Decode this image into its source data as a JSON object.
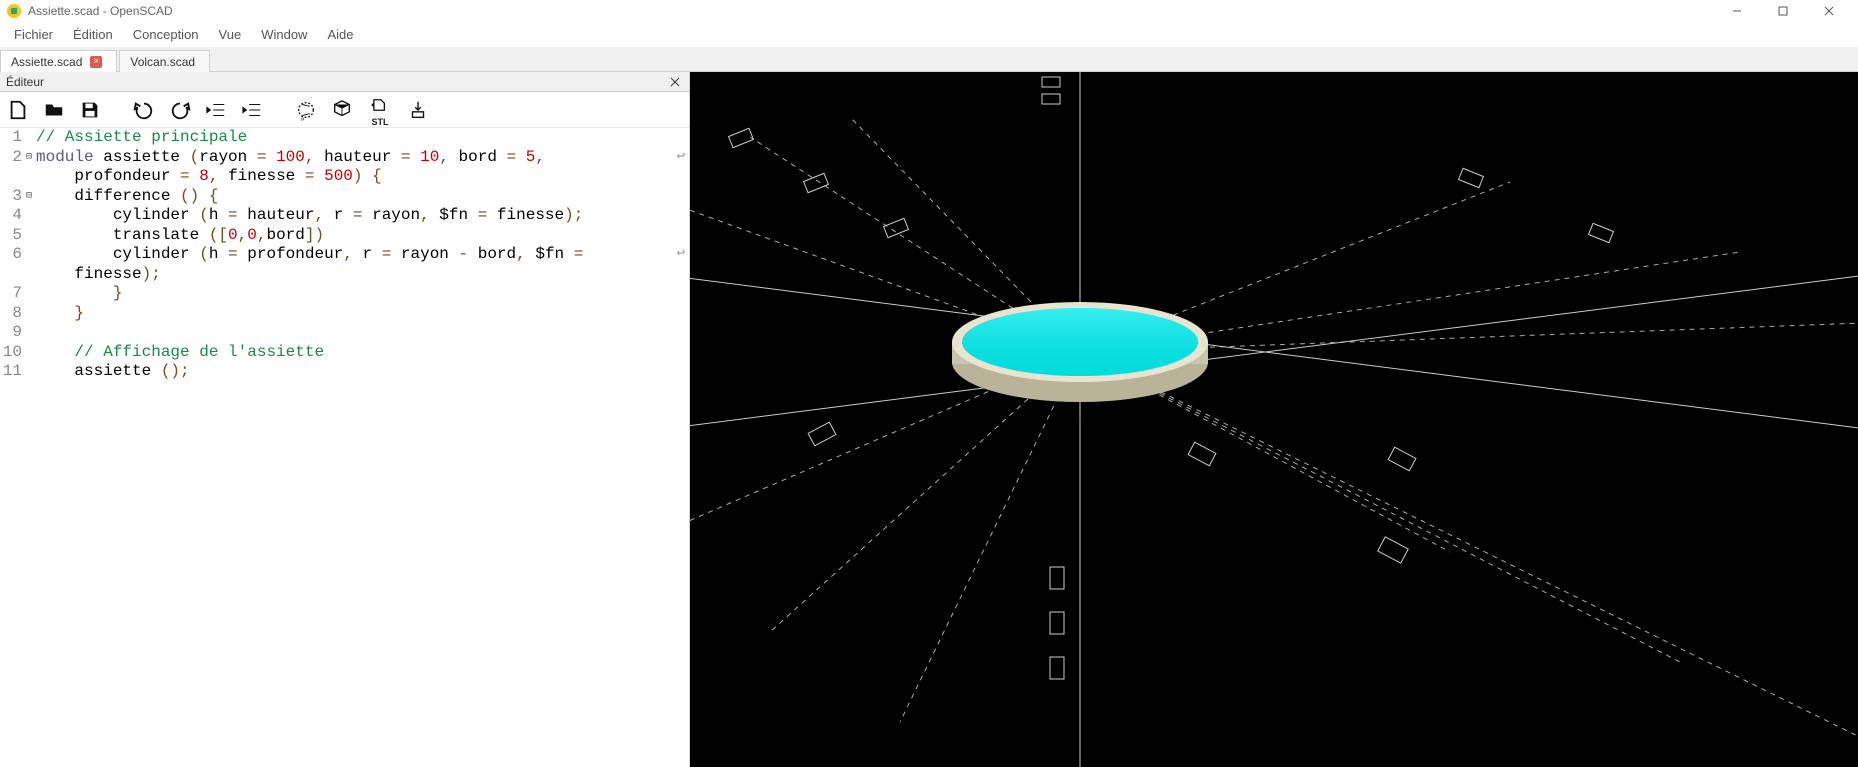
{
  "window": {
    "title": "Assiette.scad - OpenSCAD"
  },
  "menu": {
    "items": [
      "Fichier",
      "Édition",
      "Conception",
      "Vue",
      "Window",
      "Aide"
    ]
  },
  "tabs": [
    {
      "label": "Assiette.scad",
      "active": true,
      "closable": true
    },
    {
      "label": "Volcan.scad",
      "active": false,
      "closable": false
    }
  ],
  "panel": {
    "editor_title": "Éditeur"
  },
  "toolbar": {
    "items": [
      "new",
      "open",
      "save",
      "undo",
      "redo",
      "unindent",
      "indent",
      "preview",
      "render",
      "export-stl",
      "send-3d"
    ]
  },
  "code": {
    "lines": [
      {
        "n": 1,
        "fold": "",
        "segments": [
          {
            "t": "// Assiette principale",
            "c": "comment"
          }
        ]
      },
      {
        "n": 2,
        "fold": "⊟",
        "wrap": true,
        "segments": [
          {
            "t": "module",
            "c": "keyword"
          },
          {
            "t": " assiette ",
            "c": ""
          },
          {
            "t": "(",
            "c": "paren"
          },
          {
            "t": "rayon ",
            "c": ""
          },
          {
            "t": "=",
            "c": "op"
          },
          {
            "t": " ",
            "c": ""
          },
          {
            "t": "100",
            "c": "number"
          },
          {
            "t": ", ",
            "c": "paren"
          },
          {
            "t": "hauteur ",
            "c": ""
          },
          {
            "t": "=",
            "c": "op"
          },
          {
            "t": " ",
            "c": ""
          },
          {
            "t": "10",
            "c": "number"
          },
          {
            "t": ", ",
            "c": "paren"
          },
          {
            "t": "bord ",
            "c": ""
          },
          {
            "t": "=",
            "c": "op"
          },
          {
            "t": " ",
            "c": ""
          },
          {
            "t": "5",
            "c": "number"
          },
          {
            "t": ", ",
            "c": "paren"
          }
        ]
      },
      {
        "n": "",
        "fold": "",
        "segments": [
          {
            "t": "    profondeur ",
            "c": ""
          },
          {
            "t": "=",
            "c": "op"
          },
          {
            "t": " ",
            "c": ""
          },
          {
            "t": "8",
            "c": "number"
          },
          {
            "t": ", ",
            "c": "paren"
          },
          {
            "t": "finesse ",
            "c": ""
          },
          {
            "t": "=",
            "c": "op"
          },
          {
            "t": " ",
            "c": ""
          },
          {
            "t": "500",
            "c": "number"
          },
          {
            "t": ") {",
            "c": "paren"
          }
        ]
      },
      {
        "n": 3,
        "fold": "⊟",
        "segments": [
          {
            "t": "    difference ",
            "c": ""
          },
          {
            "t": "() {",
            "c": "paren"
          }
        ]
      },
      {
        "n": 4,
        "fold": "",
        "segments": [
          {
            "t": "        cylinder ",
            "c": ""
          },
          {
            "t": "(",
            "c": "paren"
          },
          {
            "t": "h ",
            "c": ""
          },
          {
            "t": "=",
            "c": "op"
          },
          {
            "t": " hauteur",
            "c": ""
          },
          {
            "t": ", ",
            "c": "paren"
          },
          {
            "t": "r ",
            "c": ""
          },
          {
            "t": "=",
            "c": "op"
          },
          {
            "t": " rayon",
            "c": ""
          },
          {
            "t": ", ",
            "c": "paren"
          },
          {
            "t": "$fn ",
            "c": ""
          },
          {
            "t": "=",
            "c": "op"
          },
          {
            "t": " finesse",
            "c": ""
          },
          {
            "t": ");",
            "c": "paren"
          }
        ]
      },
      {
        "n": 5,
        "fold": "",
        "segments": [
          {
            "t": "        translate ",
            "c": ""
          },
          {
            "t": "([",
            "c": "paren"
          },
          {
            "t": "0",
            "c": "number"
          },
          {
            "t": ",",
            "c": "paren"
          },
          {
            "t": "0",
            "c": "number"
          },
          {
            "t": ",",
            "c": "paren"
          },
          {
            "t": "bord",
            "c": ""
          },
          {
            "t": "])",
            "c": "paren"
          }
        ]
      },
      {
        "n": 6,
        "fold": "",
        "wrap": true,
        "segments": [
          {
            "t": "        cylinder ",
            "c": ""
          },
          {
            "t": "(",
            "c": "paren"
          },
          {
            "t": "h ",
            "c": ""
          },
          {
            "t": "=",
            "c": "op"
          },
          {
            "t": " profondeur",
            "c": ""
          },
          {
            "t": ", ",
            "c": "paren"
          },
          {
            "t": "r ",
            "c": ""
          },
          {
            "t": "=",
            "c": "op"
          },
          {
            "t": " rayon ",
            "c": ""
          },
          {
            "t": "-",
            "c": "op"
          },
          {
            "t": " bord",
            "c": ""
          },
          {
            "t": ", ",
            "c": "paren"
          },
          {
            "t": "$fn ",
            "c": ""
          },
          {
            "t": "=",
            "c": "op"
          },
          {
            "t": " ",
            "c": ""
          }
        ]
      },
      {
        "n": "",
        "fold": "",
        "segments": [
          {
            "t": "    finesse",
            "c": ""
          },
          {
            "t": ");",
            "c": "paren"
          }
        ]
      },
      {
        "n": 7,
        "fold": "",
        "segments": [
          {
            "t": "        }",
            "c": "paren"
          }
        ]
      },
      {
        "n": 8,
        "fold": "",
        "segments": [
          {
            "t": "    }",
            "c": "paren"
          }
        ]
      },
      {
        "n": 9,
        "fold": "",
        "segments": [
          {
            "t": "",
            "c": ""
          }
        ]
      },
      {
        "n": 10,
        "fold": "",
        "segments": [
          {
            "t": "    // Affichage de l'assiette",
            "c": "comment"
          }
        ]
      },
      {
        "n": 11,
        "fold": "",
        "segments": [
          {
            "t": "    assiette ",
            "c": ""
          },
          {
            "t": "();",
            "c": "paren"
          }
        ]
      }
    ]
  },
  "viewport": {
    "object": "plate-cylinder",
    "colors": {
      "top": "#00e5e5",
      "side": "#d9d6c2",
      "bg": "#000000",
      "axis": "#cccccc"
    }
  }
}
